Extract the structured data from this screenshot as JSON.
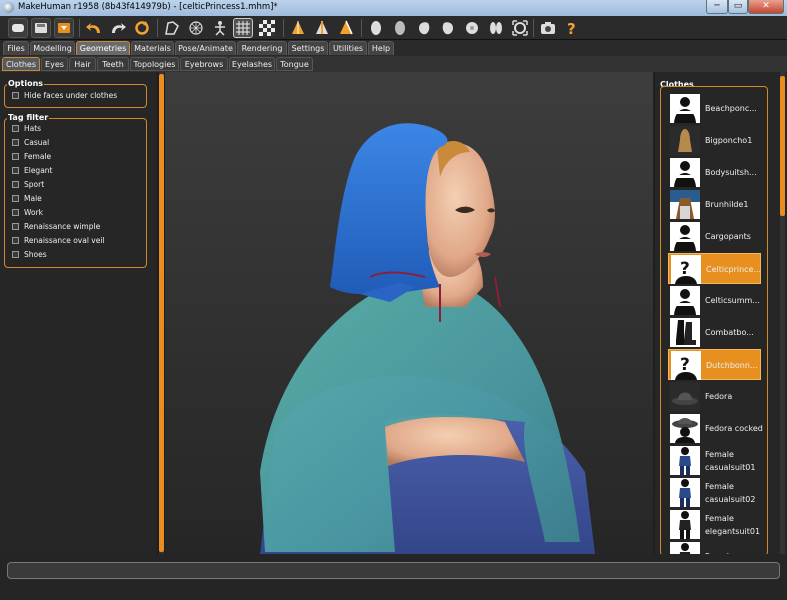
{
  "window": {
    "title": "MakeHuman r1958 (8b43f414979b) - [celticPrincess1.mhm]*",
    "minimize": "─",
    "maximize": "▭",
    "close": "✕"
  },
  "menu_tabs": [
    {
      "label": "Files"
    },
    {
      "label": "Modelling"
    },
    {
      "label": "Geometries",
      "active": true
    },
    {
      "label": "Materials"
    },
    {
      "label": "Pose/Animate"
    },
    {
      "label": "Rendering"
    },
    {
      "label": "Settings"
    },
    {
      "label": "Utilities"
    },
    {
      "label": "Help"
    }
  ],
  "sub_tabs": [
    {
      "label": "Clothes",
      "active": true
    },
    {
      "label": "Eyes"
    },
    {
      "label": "Hair"
    },
    {
      "label": "Teeth"
    },
    {
      "label": "Topologies"
    },
    {
      "label": "Eyebrows"
    },
    {
      "label": "Eyelashes"
    },
    {
      "label": "Tongue"
    }
  ],
  "options": {
    "title": "Options",
    "hide_faces_label": "Hide faces under clothes"
  },
  "tag_filter": {
    "title": "Tag filter",
    "tags": [
      "Hats",
      "Casual",
      "Female",
      "Elegant",
      "Sport",
      "Male",
      "Work",
      "Renaissance wimple",
      "Renaissance oval veil",
      "Shoes"
    ]
  },
  "clothes": {
    "title": "Clothes",
    "items": [
      {
        "label": "Beachponc...",
        "icon": "notfound",
        "selected": false
      },
      {
        "label": "Bigponcho1",
        "icon": "poncho",
        "selected": false
      },
      {
        "label": "Bodysuitsh...",
        "icon": "notfound",
        "selected": false
      },
      {
        "label": "Brunhilde1",
        "icon": "brunhilde",
        "selected": false
      },
      {
        "label": "Cargopants",
        "icon": "notfound",
        "selected": false
      },
      {
        "label": "Celticprince...",
        "icon": "unknown",
        "selected": true
      },
      {
        "label": "Celticsumm...",
        "icon": "notfound",
        "selected": false
      },
      {
        "label": "Combatbo...",
        "icon": "boots",
        "selected": false
      },
      {
        "label": "Dutchbonn...",
        "icon": "unknown",
        "selected": true
      },
      {
        "label": "Fedora",
        "icon": "hat",
        "selected": false
      },
      {
        "label": "Fedora cocked",
        "icon": "hat-cocked",
        "selected": false
      },
      {
        "label": "Female casualsuit01",
        "icon": "suit-blue",
        "selected": false
      },
      {
        "label": "Female casualsuit02",
        "icon": "suit-blue",
        "selected": false
      },
      {
        "label": "Female elegantsuit01",
        "icon": "suit-black",
        "selected": false
      },
      {
        "label": "Female",
        "icon": "suit-black",
        "selected": false
      }
    ]
  },
  "colors": {
    "accent": "#e8901f",
    "hood": "#2b6fd1",
    "poncho": "#4fa3a6",
    "dress": "#3f58a8"
  }
}
